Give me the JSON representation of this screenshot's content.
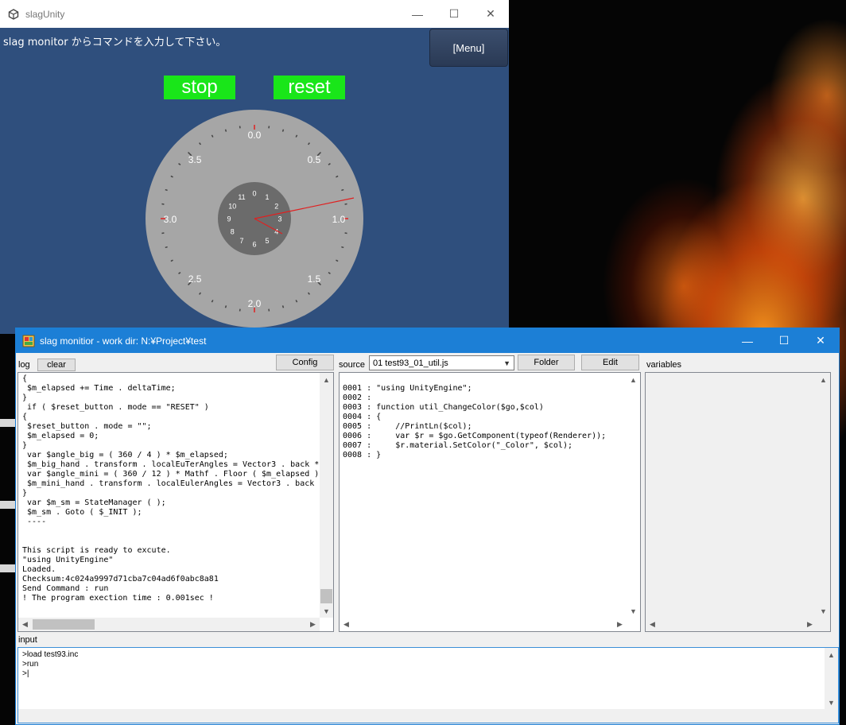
{
  "unity": {
    "title": "slagUnity",
    "hint": "slag monitor からコマンドを入力して下さい。",
    "menu_label": "[Menu]",
    "stop_label": "stop",
    "reset_label": "reset",
    "dial_labels": [
      "0.0",
      "0.5",
      "1.0",
      "1.5",
      "2.0",
      "2.5",
      "3.0",
      "3.5"
    ],
    "mini_labels": [
      "0",
      "1",
      "2",
      "3",
      "4",
      "5",
      "6",
      "7",
      "8",
      "9",
      "10",
      "11"
    ],
    "colors": {
      "window_bg": "#2f4f7d",
      "button_green": "#19e619",
      "dial_outer": "#a6a6a6",
      "dial_inner": "#6b6b6b",
      "hand": "#e02020"
    }
  },
  "monitor": {
    "title": "slag monitior - work dir: N:¥Project¥test",
    "log_label": "log",
    "clear_label": "clear",
    "config_label": "Config",
    "source_label": "source",
    "source_selected": "01 test93_01_util.js",
    "folder_label": "Folder",
    "edit_label": "Edit",
    "variables_label": "variables",
    "input_label": "input",
    "log_lines": [
      "{",
      " $m_elapsed += Time . deltaTime;",
      "}",
      " if ( $reset_button . mode == \"RESET\" )",
      "{",
      " $reset_button . mode = \"\";",
      " $m_elapsed = 0;",
      "}",
      " var $angle_big = ( 360 / 4 ) * $m_elapsed;",
      " $m_big_hand . transform . localEuTerAngles = Vector3 . back *",
      " var $angle_mini = ( 360 / 12 ) * Mathf . Floor ( $m_elapsed )",
      " $m_mini_hand . transform . localEulerAngles = Vector3 . back",
      "}",
      " var $m_sm = StateManager ( );",
      " $m_sm . Goto ( $_INIT );",
      " ----",
      "",
      "",
      "This script is ready to excute.",
      "\"using UnityEngine\"",
      "Loaded.",
      "Checksum:4c024a9997d71cba7c04ad6f0abc8a81",
      "Send Command : run",
      "! The program exection time : 0.001sec !"
    ],
    "source_lines": [
      {
        "num": "0001",
        "text": "\"using UnityEngine\";"
      },
      {
        "num": "0002",
        "text": ""
      },
      {
        "num": "0003",
        "text": "function util_ChangeColor($go,$col)"
      },
      {
        "num": "0004",
        "text": "{"
      },
      {
        "num": "0005",
        "text": "    //PrintLn($col);"
      },
      {
        "num": "0006",
        "text": "    var $r = $go.GetComponent(typeof(Renderer));"
      },
      {
        "num": "0007",
        "text": "    $r.material.SetColor(\"_Color\", $col);"
      },
      {
        "num": "0008",
        "text": "}"
      }
    ],
    "input_lines": [
      ">load test93.inc",
      ">run",
      ">|"
    ]
  }
}
